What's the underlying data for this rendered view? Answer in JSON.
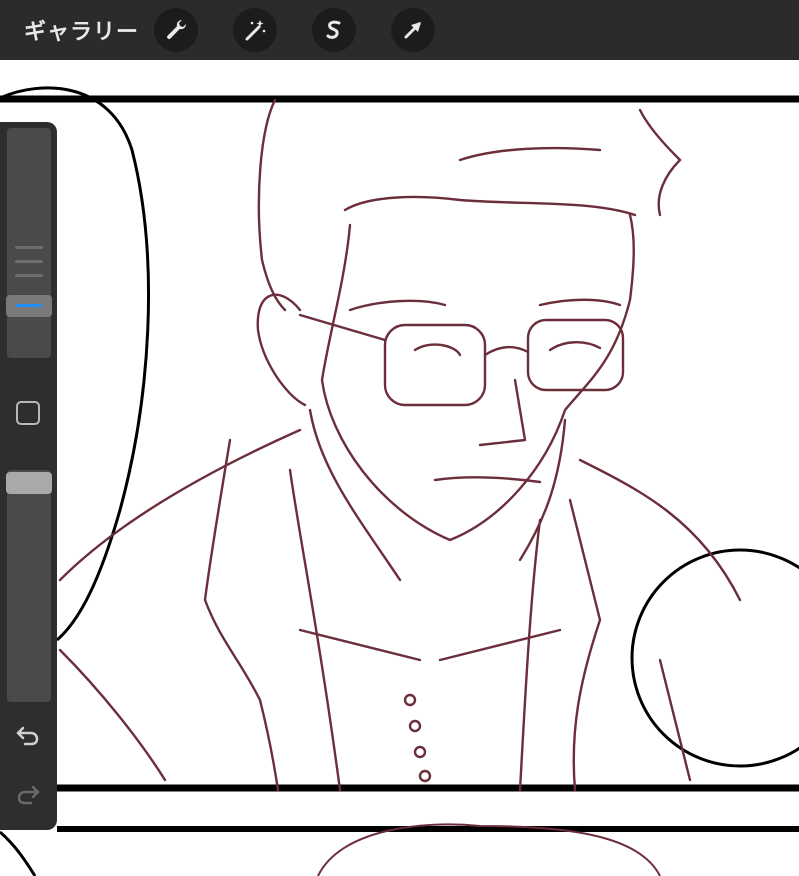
{
  "topbar": {
    "gallery_label": "ギャラリー",
    "tools": [
      {
        "icon": "wrench-icon"
      },
      {
        "icon": "magic-wand-icon"
      },
      {
        "icon": "selection-s-icon"
      },
      {
        "icon": "arrow-cursor-icon"
      }
    ]
  },
  "sidebar": {
    "brush_size_icon": "size-slider-icon",
    "modify_button_icon": "square-icon",
    "opacity_icon": "opacity-slider-icon",
    "undo_icon": "undo-icon",
    "redo_icon": "redo-icon"
  },
  "colors": {
    "toolbar_bg": "#2b2b2b",
    "sidebar_bg": "#2e2e2e",
    "accent": "#1e90ff",
    "sketch_stroke": "#6b2e3a",
    "panel_line": "#000000"
  }
}
